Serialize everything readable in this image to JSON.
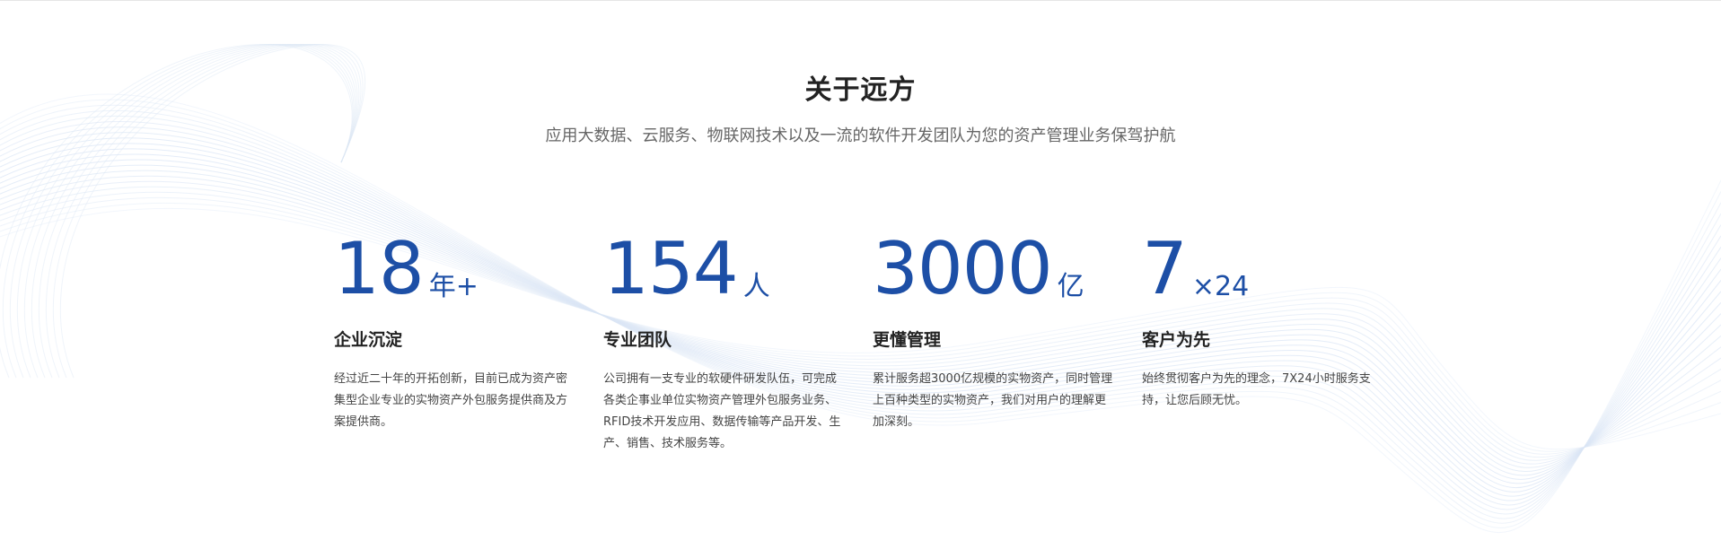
{
  "section": {
    "title": "关于远方",
    "subtitle": "应用大数据、云服务、物联网技术以及一流的软件开发团队为您的资产管理业务保驾护航"
  },
  "stats": [
    {
      "number": "18",
      "unit": "年+",
      "heading": "企业沉淀",
      "description": "经过近二十年的开拓创新，目前已成为资产密集型企业专业的实物资产外包服务提供商及方案提供商。"
    },
    {
      "number": "154",
      "unit": "人",
      "heading": "专业团队",
      "description": "公司拥有一支专业的软硬件研发队伍，可完成各类企事业单位实物资产管理外包服务业务、RFID技术开发应用、数据传输等产品开发、生产、销售、技术服务等。"
    },
    {
      "number": "3000",
      "unit": "亿",
      "heading": "更懂管理",
      "description": "累计服务超3000亿规模的实物资产，同时管理上百种类型的实物资产，我们对用户的理解更加深刻。"
    },
    {
      "number": "7",
      "unit": "×24",
      "heading": "客户为先",
      "description": "始终贯彻客户为先的理念，7X24小时服务支持，让您后顾无忧。"
    }
  ],
  "colors": {
    "accent": "#1d4fa6",
    "title": "#222222",
    "subtitle": "#666666",
    "body_text": "#444444",
    "wave_lines": "#dbe6f5"
  }
}
